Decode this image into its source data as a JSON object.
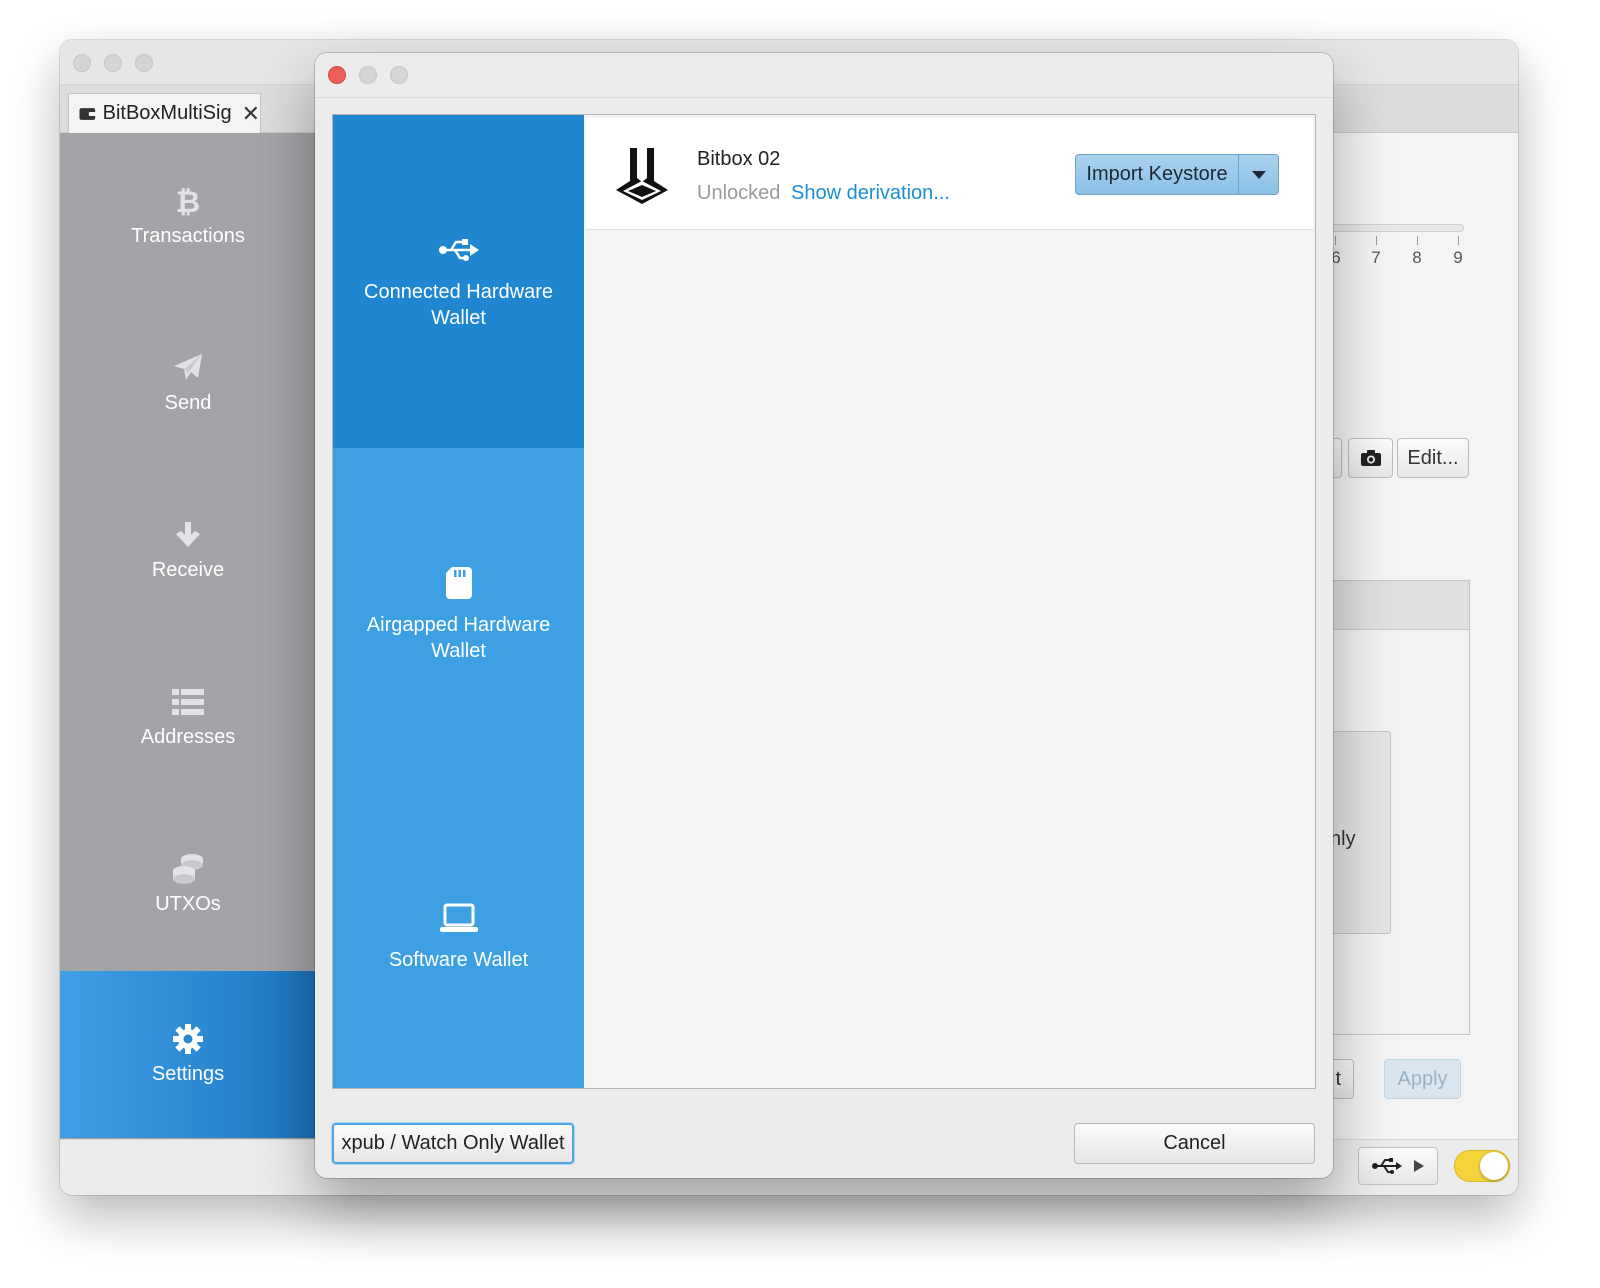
{
  "main_window": {
    "tab_label": "BitBoxMultiSig",
    "tab_close": "✕",
    "nav": [
      {
        "label": "Transactions",
        "icon": "bitcoin-icon"
      },
      {
        "label": "Send",
        "icon": "paper-plane-icon"
      },
      {
        "label": "Receive",
        "icon": "arrow-down-icon"
      },
      {
        "label": "Addresses",
        "icon": "list-icon"
      },
      {
        "label": "UTXOs",
        "icon": "coins-icon"
      },
      {
        "label": "Settings",
        "icon": "gear-icon",
        "active": true
      }
    ],
    "background": {
      "ticks": [
        "6",
        "7",
        "8",
        "9"
      ],
      "edit_button": "Edit...",
      "card_text": "nly",
      "partial_button": "t",
      "apply_button": "Apply"
    }
  },
  "dialog": {
    "categories": [
      {
        "label": "Connected Hardware Wallet",
        "icon": "usb-icon",
        "selected": true
      },
      {
        "label": "Airgapped Hardware Wallet",
        "icon": "sd-card-icon"
      },
      {
        "label": "Software Wallet",
        "icon": "laptop-icon"
      }
    ],
    "device": {
      "name": "Bitbox 02",
      "status": "Unlocked",
      "derivation_link": "Show derivation...",
      "import_button": "Import Keystore"
    },
    "buttons": {
      "xpub": "xpub / Watch Only Wallet",
      "cancel": "Cancel"
    }
  },
  "colors": {
    "accent_blue": "#3da0e3",
    "selected_blue": "#1f87cf",
    "link_blue": "#1a8fd0",
    "close_red": "#ed5e57",
    "toggle_yellow": "#f4d43a"
  }
}
